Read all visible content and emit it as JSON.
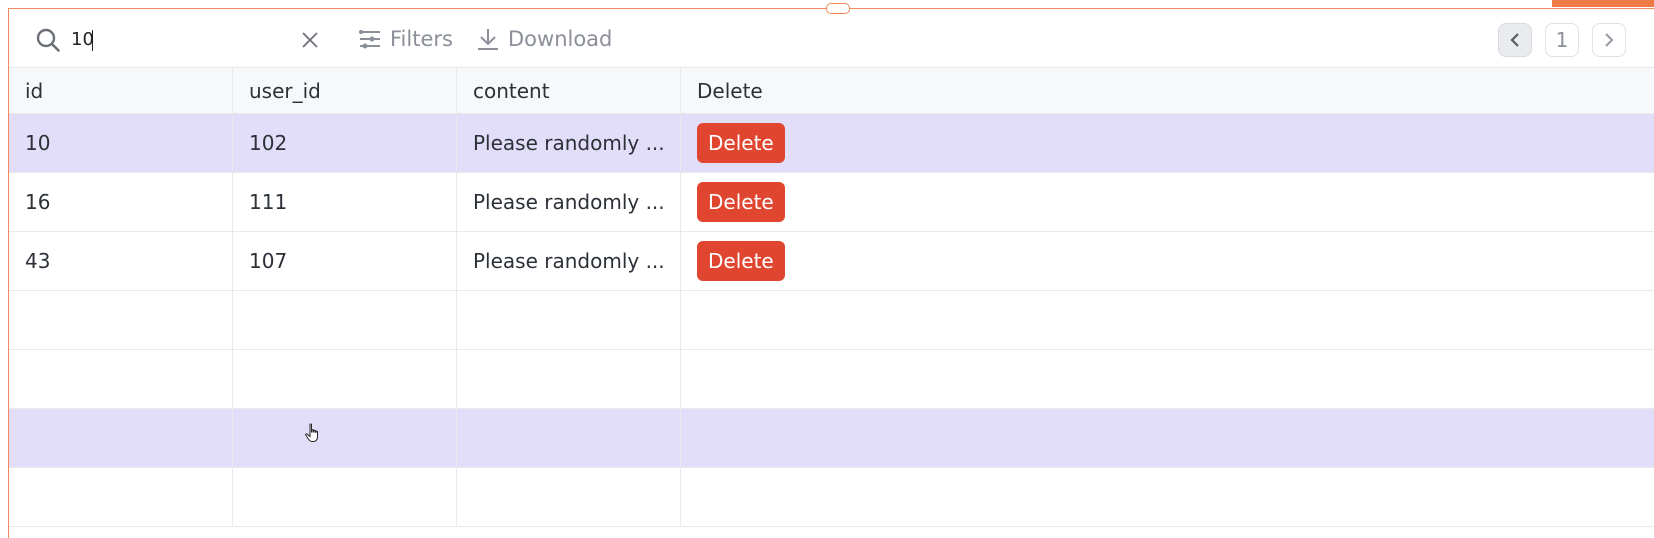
{
  "search": {
    "value": "10"
  },
  "toolbar": {
    "filters_label": "Filters",
    "download_label": "Download"
  },
  "pagination": {
    "current_page": "1"
  },
  "table": {
    "columns": [
      "id",
      "user_id",
      "content",
      "Delete"
    ],
    "rows": [
      {
        "id": "10",
        "user_id": "102",
        "content": "Please randomly ...",
        "action": "Delete"
      },
      {
        "id": "16",
        "user_id": "111",
        "content": "Please randomly ...",
        "action": "Delete"
      },
      {
        "id": "43",
        "user_id": "107",
        "content": "Please randomly ...",
        "action": "Delete"
      }
    ]
  },
  "colors": {
    "accent_border": "#f08a5d",
    "delete_button": "#e0462f",
    "selected_row": "#e2defa"
  },
  "icons": [
    "search-icon",
    "clear-icon",
    "filters-icon",
    "download-icon",
    "chevron-left-icon",
    "chevron-right-icon",
    "hand-cursor-icon"
  ]
}
